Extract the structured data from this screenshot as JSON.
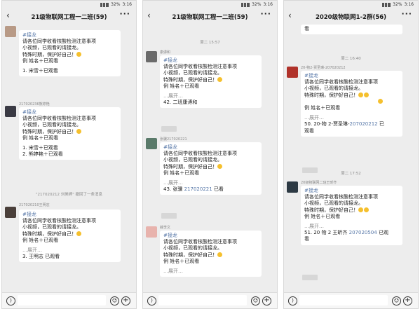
{
  "status_bar": {
    "signal": "ıll",
    "battery": "32%",
    "time": "3:16"
  },
  "panels": [
    {
      "title": "21级物联网工程一二班(59)",
      "rows": [
        {
          "sender": "",
          "lines": [
            "#接龙",
            "请各位同学收看核酸检测注意事项",
            "小视频，已观看的请接龙。",
            "特殊时期，保护好自己！",
            "例 姓名＋已观看",
            "",
            "1. 宋雪＋已观看"
          ]
        },
        {
          "sender": "217020236熊婷艳",
          "lines": [
            "#接龙",
            "请各位同学收看核酸检测注意事项",
            "小视频，已观看的请接龙。",
            "特殊时期，保护好自己！",
            "例 姓名＋已观看",
            "",
            "1. 宋雪＋已观看",
            "2. 熊婷艳＋已观看"
          ]
        },
        {
          "sender": "217020210王明志",
          "lines": [
            "#接龙",
            "请各位同学收看核酸检测注意事项",
            "小视频，已观看的请接龙。",
            "特殊时期，保护好自己！",
            "例 姓名＋已观看"
          ],
          "expand": "…展开…",
          "last": "3. 王明志 已观看"
        }
      ],
      "sysmsg": "\"217020212 刘美婷\" 撤回了一条消息"
    },
    {
      "title": "21级物联网工程一二班(59)",
      "timestamp_top": "周二 15:57",
      "rows": [
        {
          "sender": "康濞和",
          "lines": [
            "#接龙",
            "请各位同学收看核酸检测注意事项",
            "小视频，已观看的请接龙。",
            "特殊时期，保护好自己！",
            "例 姓名＋已观看"
          ],
          "expand": "…展开…",
          "last": "42. 二班康溥和"
        },
        {
          "sender": "张骥217020221",
          "lines": [
            "#接龙",
            "请各位同学收看核酸检测注意事项",
            "小视频，已观看的请接龙。",
            "特殊时期，保护好自己！",
            "例 姓名＋已观看"
          ],
          "expand": "…展开…",
          "last_prefix": "43. 张骥 ",
          "last_link": "217020221",
          "last_suffix": " 已看"
        },
        {
          "sender": "薛李文",
          "lines": [
            "#接龙",
            "请各位同学收看核酸检测注意事项",
            "小视频，已观看的请接龙。",
            "特殊时期，保护好自己！",
            "例 姓名＋已观看"
          ],
          "expand": "…展开…"
        }
      ]
    },
    {
      "title": "2020级物联网1-2群(56)",
      "top_text": "看",
      "timestamp_1": "周二 16:40",
      "timestamp_2": "周二 17:52",
      "rows": [
        {
          "sender": "20-物2-贾圣琳-207020212",
          "lines": [
            "#接龙",
            "请各位同学收看核酸检测注意事项",
            "小视频，已观看的请接龙。",
            "特殊时期，保护好自己！",
            "",
            "例 姓名＋已观看"
          ],
          "expand": "…展开…",
          "last_prefix": "50. 20-物 2-贾圣琳-",
          "last_link": "207020212",
          "last_suffix": " 已",
          "last_line2": "观看"
        },
        {
          "sender": "20级物联网二班王昕齐",
          "lines": [
            "#接龙",
            "请各位同学收看核酸检测注意事项",
            "小视频，已观看的请接龙。",
            "特殊时期，保护好自己！",
            "例 姓名＋已观看"
          ],
          "expand": "…展开…",
          "last_prefix": "51. 20 物 2 王昕齐 ",
          "last_link": "207020504",
          "last_suffix": " 已观",
          "last_line2": "看"
        }
      ]
    }
  ],
  "input_bar": {
    "voice_icon": "voice-icon",
    "emoji_icon": "emoji-icon",
    "plus_icon": "plus-icon"
  },
  "colors": {
    "background": "#ededed",
    "bubble": "#ffffff",
    "link": "#5576a7",
    "meta": "#8a8a8a"
  }
}
